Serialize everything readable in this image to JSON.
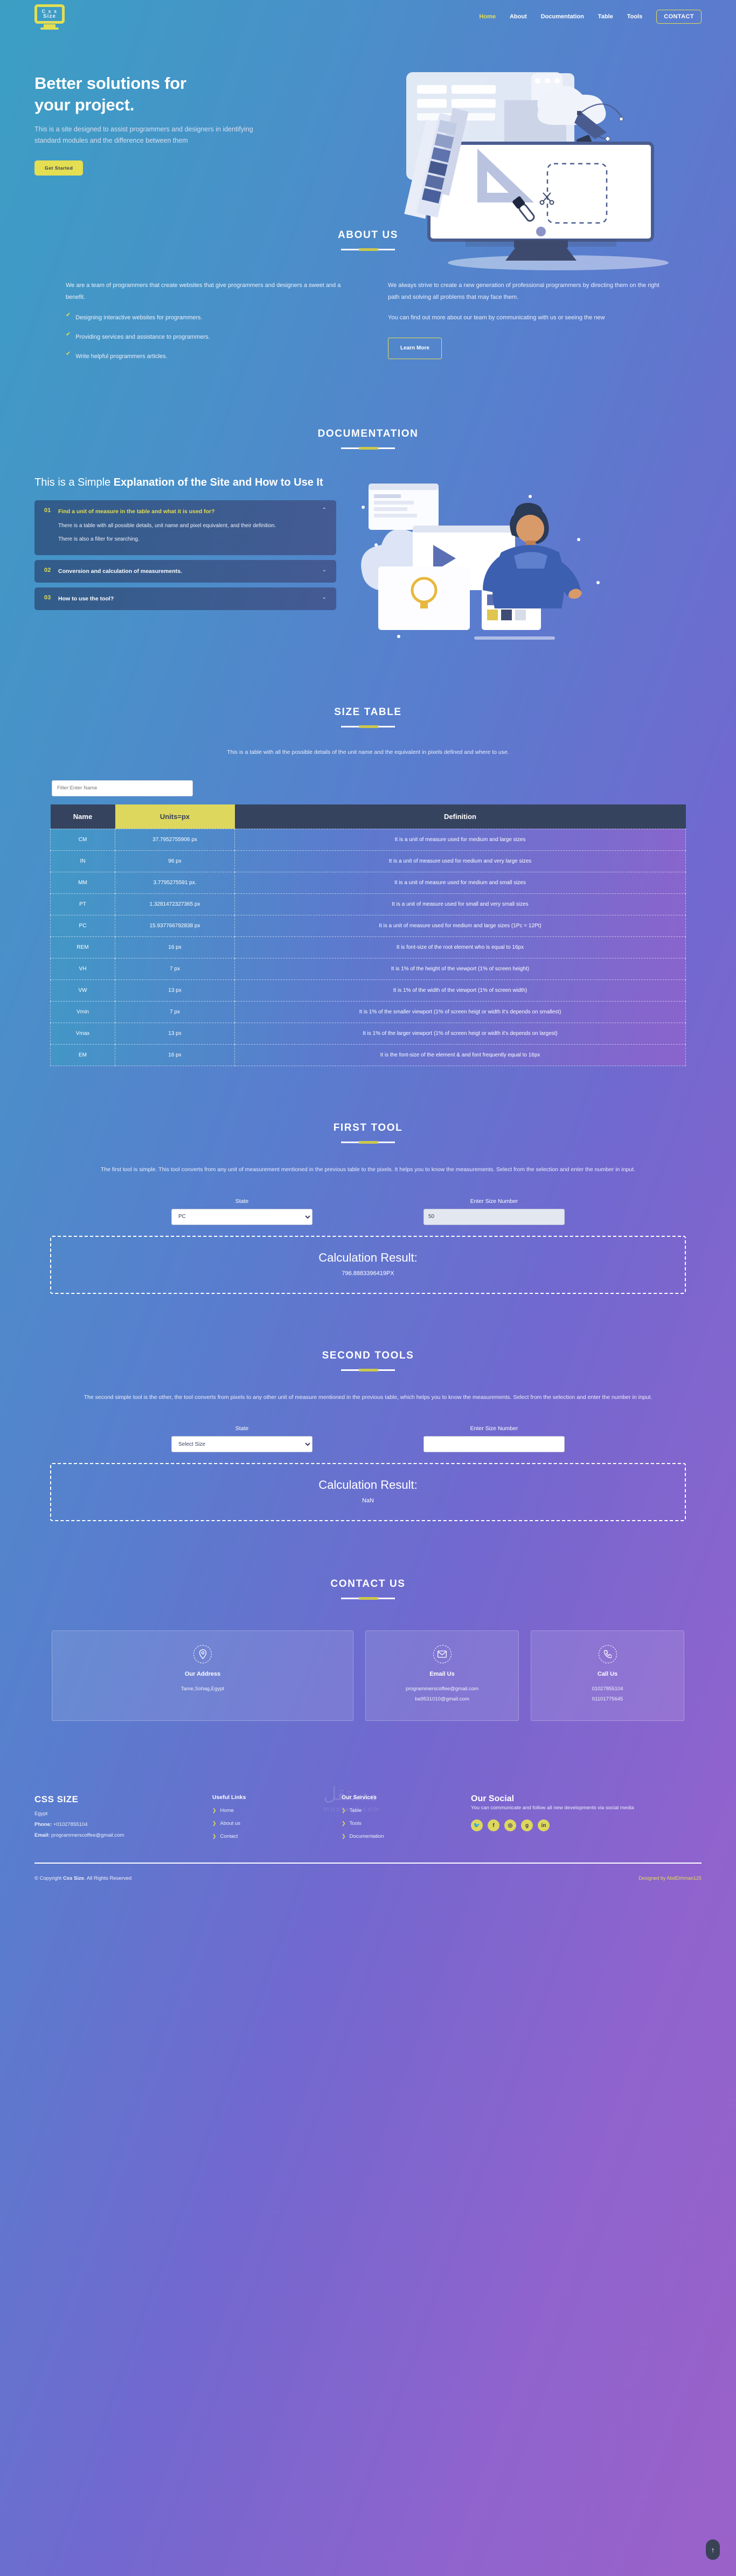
{
  "brand": {
    "logo_line1": "C s s",
    "logo_line2": "Size",
    "name": "CSS SIZE"
  },
  "nav": {
    "items": [
      {
        "label": "Home",
        "active": true
      },
      {
        "label": "About",
        "active": false
      },
      {
        "label": "Documentation",
        "active": false
      },
      {
        "label": "Table",
        "active": false
      },
      {
        "label": "Tools",
        "active": false
      }
    ],
    "contact_label": "CONTACT"
  },
  "hero": {
    "title_line1": "Better solutions for",
    "title_line2": "your project.",
    "subtitle": "This is a site designed to assist programmers and designers in identifying standard modules and the difference between them",
    "cta": "Get Started"
  },
  "about": {
    "title": "ABOUT US",
    "left_intro": "We are a team of programmers that create websites that give programmers and designers a sweet and a benefit.",
    "features": [
      "Designing interactive websites for programmers.",
      "Providing services and assistance to programmers.",
      "Write helpful programmers articles."
    ],
    "right_p1": "We always strive to create a new generation of professional programmers by directing them on the right path and solving all problems that may face them.",
    "right_p2": "You can find out more about our team by communicating with us or seeing the new",
    "cta": "Learn More"
  },
  "documentation": {
    "title": "DOCUMENTATION",
    "heading_light": "This is a Simple ",
    "heading_bold": "Explanation of the Site and How to Use It",
    "accordion": [
      {
        "num": "01",
        "question": "Find a unit of measure in the table and what it is used for?",
        "open": true,
        "caret": "⌃",
        "body": [
          "There is a table with all possible details, unit name and pixel equivalent, and their definition.",
          "There is also a filter for searching."
        ]
      },
      {
        "num": "02",
        "question": "Conversion and calculation of measurements.",
        "open": false,
        "caret": "⌄",
        "body": []
      },
      {
        "num": "03",
        "question": "How to use the tool?",
        "open": false,
        "caret": "⌄",
        "body": []
      }
    ]
  },
  "size_table": {
    "title": "SIZE TABLE",
    "description": "This is a table with all the possible details of the unit name and the equivalent in pixels defined and where to use.",
    "filter_placeholder": "Filter:Enter Name",
    "filter_value": "",
    "columns": [
      "Name",
      "Units=px",
      "Definition"
    ],
    "rows": [
      [
        "CM",
        "37.7952755906 px",
        "It is a unit of measure used for medium and large sizes"
      ],
      [
        "IN",
        "96 px",
        "It is a unit of measure used for medium and very large sizes"
      ],
      [
        "MM",
        "3.7795275591 px.",
        "It is a unit of measure used for medium and small sizes"
      ],
      [
        "PT",
        "1.3281472327365 px",
        "It is a unit of measure used for small and very small sizes"
      ],
      [
        "PC",
        "15.937766792838 px",
        "It is a unit of measure used for medium and large sizes (1Pc = 12Pt)"
      ],
      [
        "REM",
        "16 px",
        "It is font-size of the root element who is equal to 16px"
      ],
      [
        "VH",
        "7 px",
        "It is 1% of the height of the viewport (1% of screen height)"
      ],
      [
        "VW",
        "13 px",
        "It is 1% of the width of the viewport (1% of screen width)"
      ],
      [
        "Vmin",
        "7 px",
        "It is 1% of the smaller viewport (1% of screen heigt or width it's depends on smallest)"
      ],
      [
        "Vmax",
        "13 px",
        "It is 1% of the larger viewport (1% of screen heigt or width it's depends on largest)"
      ],
      [
        "EM",
        "16 px",
        "It is the font-size of the element & and font frequently equal to 16px"
      ]
    ]
  },
  "first_tool": {
    "title": "FIRST TOOL",
    "description": "The first tool is simple. This tool converts from any unit of measurement mentioned in the previous table to the pixels. It helps you to know the measurements. Select from the selection and enter the number in input.",
    "state_label": "State",
    "state_value": "PC",
    "size_label": "Enter Size Number",
    "size_value": "50",
    "result_label": "Calculation Result:",
    "result_value": "796.8883396419PX"
  },
  "second_tool": {
    "title": "SECOND TOOLS",
    "description": "The second simple tool is the other, the tool converts from pixels to any other unit of measure mentioned in the previous table, which helps you to know the measurements. Select from the selection and enter the number in input.",
    "state_label": "State",
    "state_value": "Select Size",
    "size_label": "Enter Size Number",
    "size_value": "",
    "result_label": "Calculation Result:",
    "result_value": "NaN"
  },
  "contact": {
    "title": "CONTACT US",
    "cards": [
      {
        "icon": "map-pin-icon",
        "heading": "Our Address",
        "lines": [
          "Tame,Sohag,Egypt"
        ]
      },
      {
        "icon": "envelope-icon",
        "heading": "Email Us",
        "lines": [
          "programmerscoffee@gmail.com",
          "ba9531010@gmail.com"
        ]
      },
      {
        "icon": "phone-icon",
        "heading": "Call Us",
        "lines": [
          "01027855104",
          "01101775645"
        ]
      }
    ]
  },
  "footer": {
    "brand": "CSS SIZE",
    "location": "Egypt",
    "phone_label": "Phone:",
    "phone": "+01027855104",
    "email_label": "Email:",
    "email": "programmerscoffee@gmail.com",
    "useful_links_title": "Useful Links",
    "useful_links": [
      "Home",
      "About us",
      "Contact"
    ],
    "services_title": "Our Services",
    "services": [
      "Table",
      "Tools",
      "Documentation"
    ],
    "social_title": "Our Social",
    "social_text": "You can communicate and follow all new developments via social media",
    "socials": [
      "twitter-icon",
      "facebook-icon",
      "instagram-icon",
      "google-icon",
      "linkedin-icon"
    ],
    "social_glyphs": [
      "🐦",
      "f",
      "◎",
      "g",
      "in"
    ],
    "copyright_prefix": "© Copyright ",
    "copyright_brand": "Css Size",
    "copyright_suffix": ". All Rights Reserved",
    "designed_prefix": "Designed by ",
    "designed_by": "AbdElrhman125",
    "watermark": "مستقل",
    "watermark_sub": "mostaql.com"
  }
}
